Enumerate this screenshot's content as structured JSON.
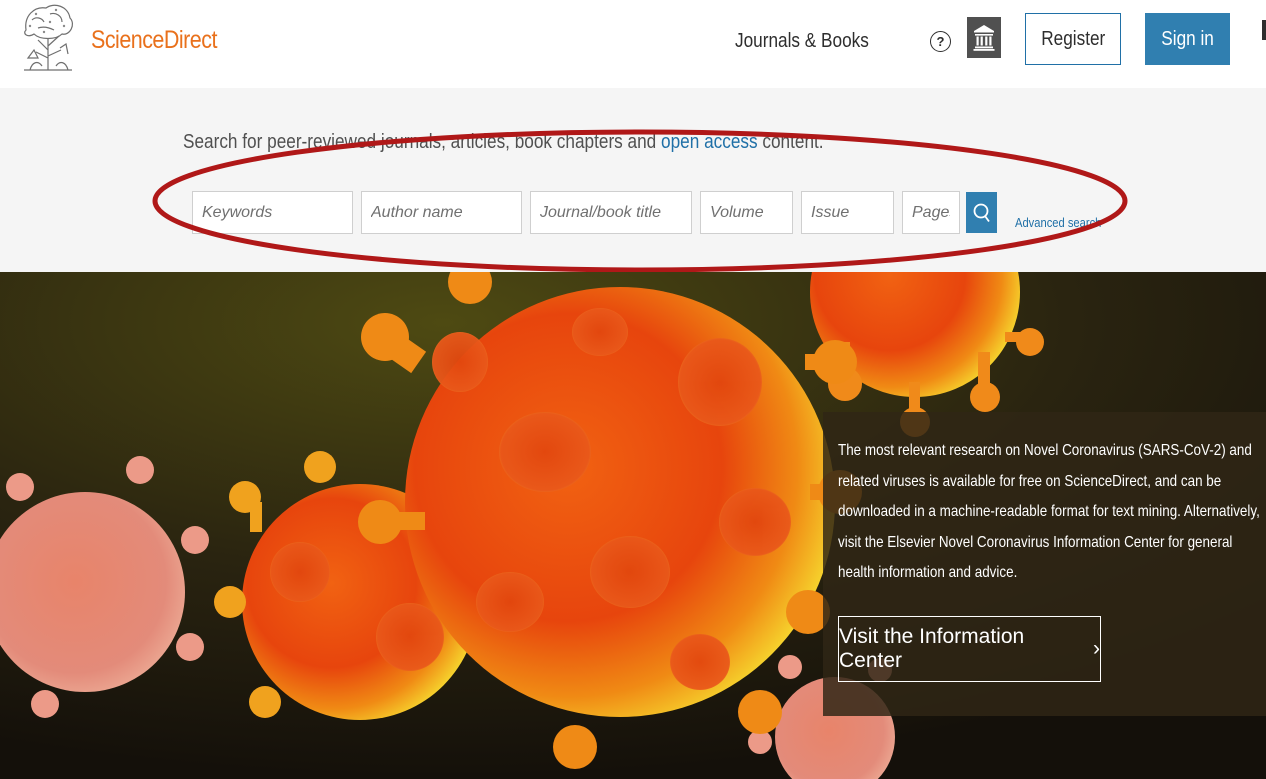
{
  "header": {
    "brand": "ScienceDirect",
    "nav_journals": "Journals & Books",
    "help_icon": "?",
    "register_label": "Register",
    "signin_label": "Sign in"
  },
  "search": {
    "intro_prefix": "Search for peer-reviewed journals, articles, book chapters and ",
    "intro_link": "open access",
    "intro_suffix": " content.",
    "fields": {
      "keywords_placeholder": "Keywords",
      "author_placeholder": "Author name",
      "journal_placeholder": "Journal/book title",
      "volume_placeholder": "Volume",
      "issue_placeholder": "Issue",
      "pages_placeholder": "Pages"
    },
    "advanced_label": "Advanced search"
  },
  "hero": {
    "info_text": "The most relevant research on Novel Coronavirus (SARS-CoV-2) and related viruses is available for free on ScienceDirect, and can be downloaded in a machine-readable format for text mining. Alternatively, visit the Elsevier Novel Coronavirus Information Center for general health information and advice.",
    "button_label": "Visit the Information Center",
    "button_chevron": "›"
  },
  "colors": {
    "brand_orange": "#e9711c",
    "link_blue": "#2070a7",
    "button_blue": "#307fb0",
    "annotation_red": "#b01818"
  },
  "icons": [
    "elsevier-tree-logo",
    "help-icon",
    "institution-icon",
    "search-icon",
    "chevron-right-icon"
  ]
}
